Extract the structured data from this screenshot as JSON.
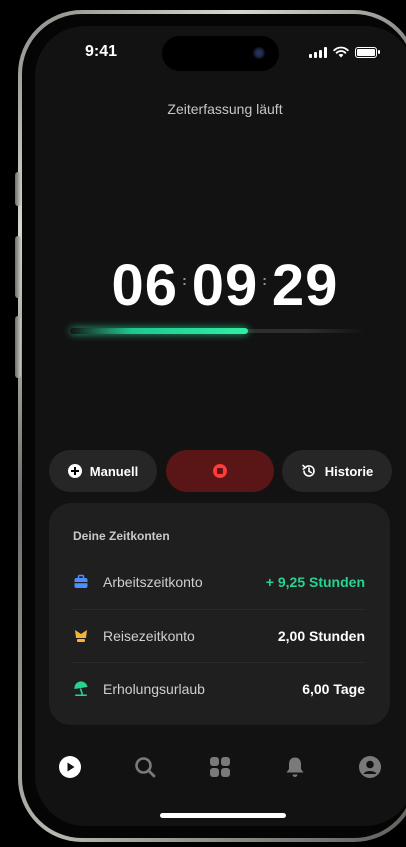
{
  "status_bar": {
    "time": "9:41"
  },
  "header": {
    "title": "Zeiterfassung läuft"
  },
  "timer": {
    "hours": "06",
    "minutes": "09",
    "seconds": "29",
    "separator": ":",
    "progress_percent": 60
  },
  "actions": {
    "manual_label": "Manuell",
    "history_label": "Historie"
  },
  "accounts": {
    "title": "Deine Zeitkonten",
    "items": [
      {
        "label": "Arbeitszeitkonto",
        "value": "+ 9,25 Stunden",
        "icon": "briefcase-icon",
        "color": "#4c8dff"
      },
      {
        "label": "Reisezeitkonto",
        "value": "2,00 Stunden",
        "icon": "travel-icon",
        "color": "#f5b23b"
      },
      {
        "label": "Erholungsurlaub",
        "value": "6,00 Tage",
        "icon": "beach-umbrella-icon",
        "color": "#27d48f"
      }
    ]
  },
  "nav": {
    "items": [
      "play-icon",
      "search-icon",
      "grid-icon",
      "bell-icon",
      "profile-icon"
    ],
    "active": "play-icon"
  },
  "colors": {
    "accent": "#27d48f",
    "stop": "#ff3b3b"
  }
}
